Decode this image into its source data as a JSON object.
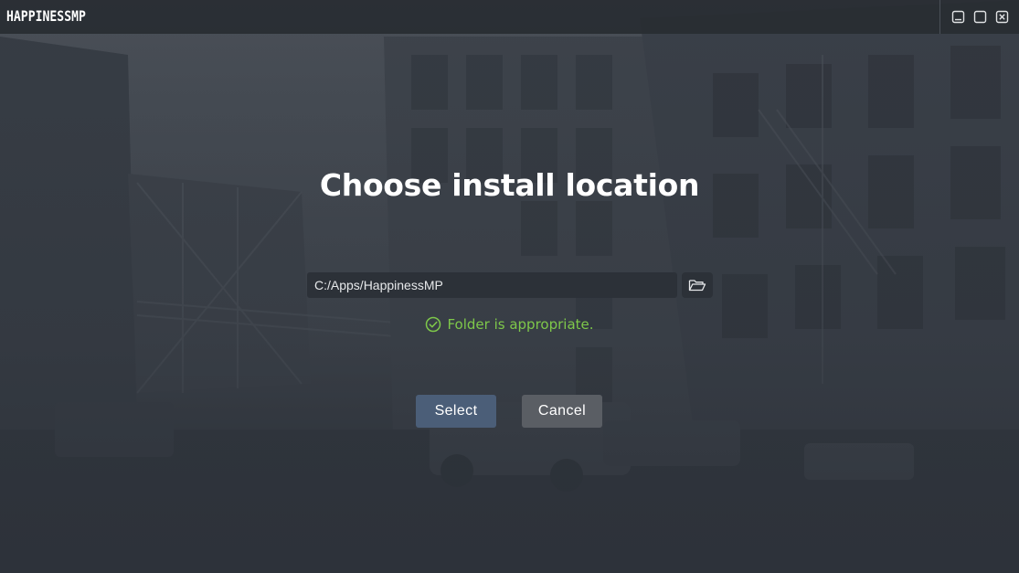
{
  "window": {
    "brand": "HappinessMP",
    "controls": {
      "minimize_icon": "minimize-icon",
      "maximize_icon": "maximize-icon",
      "close_icon": "close-icon"
    }
  },
  "dialog": {
    "title": "Choose install location",
    "path_value": "C:/Apps/HappinessMP",
    "browse_icon": "folder-open-icon",
    "status_icon": "check-circle-icon",
    "status_text": "Folder is appropriate.",
    "select_label": "Select",
    "cancel_label": "Cancel"
  },
  "colors": {
    "status_green": "#7ec84a",
    "select_button": "#4b5e78",
    "cancel_button": "#5a5e64",
    "input_background": "#2c3138"
  }
}
